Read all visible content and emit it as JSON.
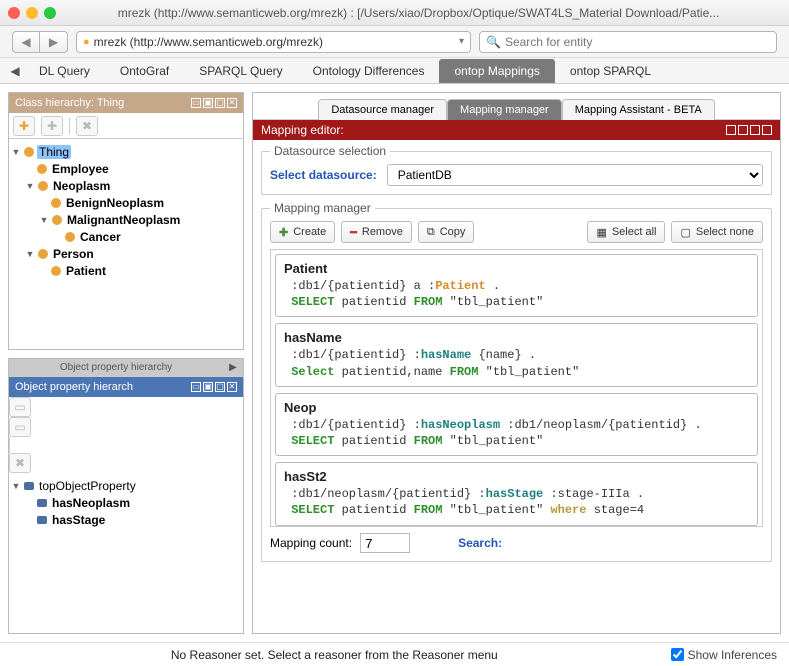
{
  "window": {
    "title": "mrezk (http://www.semanticweb.org/mrezk)  : [/Users/xiao/Dropbox/Optique/SWAT4LS_Material Download/Patie..."
  },
  "toolbar": {
    "url_display": "mrezk (http://www.semanticweb.org/mrezk)",
    "search_placeholder": "Search for entity"
  },
  "main_tabs": [
    "DL Query",
    "OntoGraf",
    "SPARQL Query",
    "Ontology Differences",
    "ontop Mappings",
    "ontop SPARQL"
  ],
  "main_tabs_active": 4,
  "class_panel": {
    "title": "Class hierarchy: Thing",
    "root": "Thing",
    "items": [
      "Employee",
      "Neoplasm",
      "BenignNeoplasm",
      "MalignantNeoplasm",
      "Cancer",
      "Person",
      "Patient"
    ]
  },
  "obj_panel": {
    "tab_label": "Object property hierarchy",
    "hdr": "Object property hierarch",
    "root": "topObjectProperty",
    "items": [
      "hasNeoplasm",
      "hasStage"
    ]
  },
  "sub_tabs": [
    "Datasource manager",
    "Mapping manager",
    "Mapping Assistant - BETA"
  ],
  "sub_tabs_active": 1,
  "mapping_editor": {
    "title": "Mapping editor:",
    "ds_legend": "Datasource selection",
    "ds_label": "Select datasource:",
    "ds_value": "PatientDB",
    "mm_legend": "Mapping manager",
    "buttons": {
      "create": "Create",
      "remove": "Remove",
      "copy": "Copy",
      "select_all": "Select all",
      "select_none": "Select none"
    },
    "mappings": [
      {
        "title": "Patient",
        "l1_pre": " :db1/{patientid} a :",
        "l1_cls": "Patient",
        "l1_post": " .",
        "sql_pre": " SELECT",
        "sql_mid": " patientid ",
        "sql_from": "FROM",
        "sql_post": " \"tbl_patient\"",
        "extra": ""
      },
      {
        "title": "hasName",
        "l1_pre": " :db1/{patientid} :",
        "l1_cls": "hasName",
        "l1_post": " {name} .",
        "sql_pre": " Select",
        "sql_mid": " patientid,name ",
        "sql_from": "FROM",
        "sql_post": " \"tbl_patient\"",
        "extra": ""
      },
      {
        "title": "Neop",
        "l1_pre": " :db1/{patientid} :",
        "l1_cls": "hasNeoplasm",
        "l1_post": " :db1/neoplasm/{patientid} .",
        "sql_pre": " SELECT",
        "sql_mid": " patientid ",
        "sql_from": "FROM",
        "sql_post": " \"tbl_patient\"",
        "extra": ""
      },
      {
        "title": "hasSt2",
        "l1_pre": " :db1/neoplasm/{patientid} :",
        "l1_cls": "hasStage",
        "l1_post": " :stage-IIIa .",
        "sql_pre": " SELECT",
        "sql_mid": " patientid ",
        "sql_from": "FROM",
        "sql_post": " \"tbl_patient\" ",
        "extra": "where",
        "extra2": " stage=4"
      }
    ],
    "count_label": "Mapping count:",
    "count_value": "7",
    "search_label": "Search:"
  },
  "status": {
    "reasoner": "No Reasoner set. Select a reasoner from the Reasoner menu",
    "show_inf": "Show Inferences"
  }
}
